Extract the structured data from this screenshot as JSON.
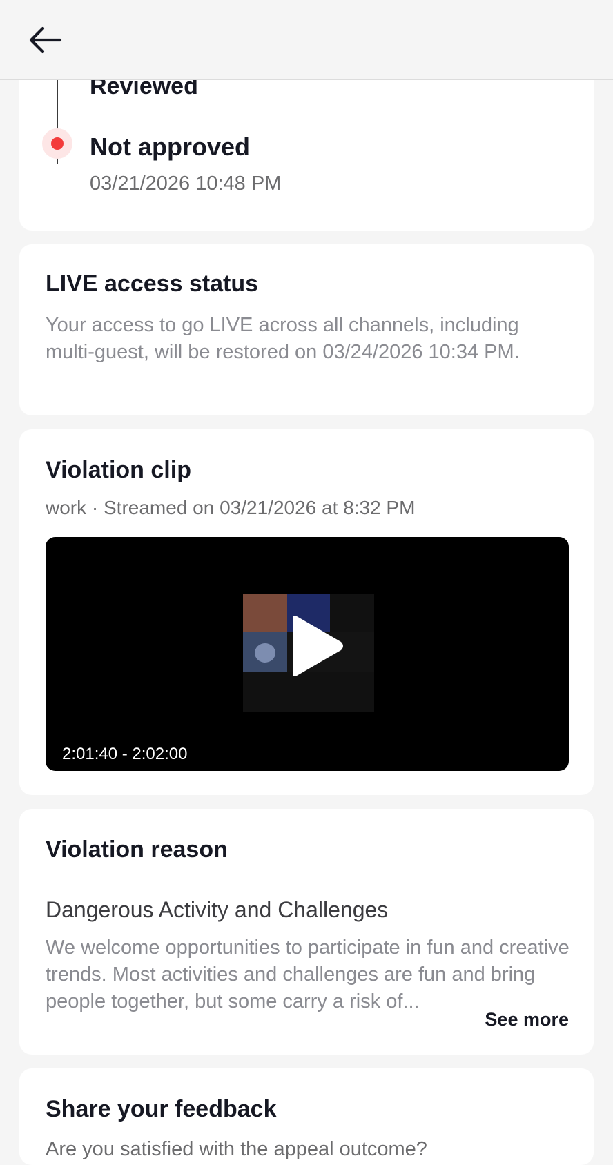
{
  "header": {
    "back_icon": "arrow-left-icon"
  },
  "timeline": {
    "previous_step": "Reviewed",
    "current_step": "Not approved",
    "current_time": "03/21/2026 10:48 PM",
    "status_color": "#f33b3b"
  },
  "live_access": {
    "title": "LIVE access status",
    "message": "Your access to go LIVE across all channels, including multi-guest, will be restored on 03/24/2026 10:34 PM."
  },
  "violation_clip": {
    "title": "Violation clip",
    "meta": "work · Streamed on 03/21/2026 at 8:32 PM",
    "time_range": "2:01:40 - 2:02:00",
    "play_icon": "play-icon"
  },
  "violation_reason": {
    "title": "Violation reason",
    "category": "Dangerous Activity and Challenges",
    "description": "We welcome opportunities to participate in fun and creative trends. Most activities and challenges are fun and bring people together, but some carry a risk of...",
    "see_more": "See more"
  },
  "feedback": {
    "title": "Share your feedback",
    "question": "Are you satisfied with the appeal outcome?"
  }
}
